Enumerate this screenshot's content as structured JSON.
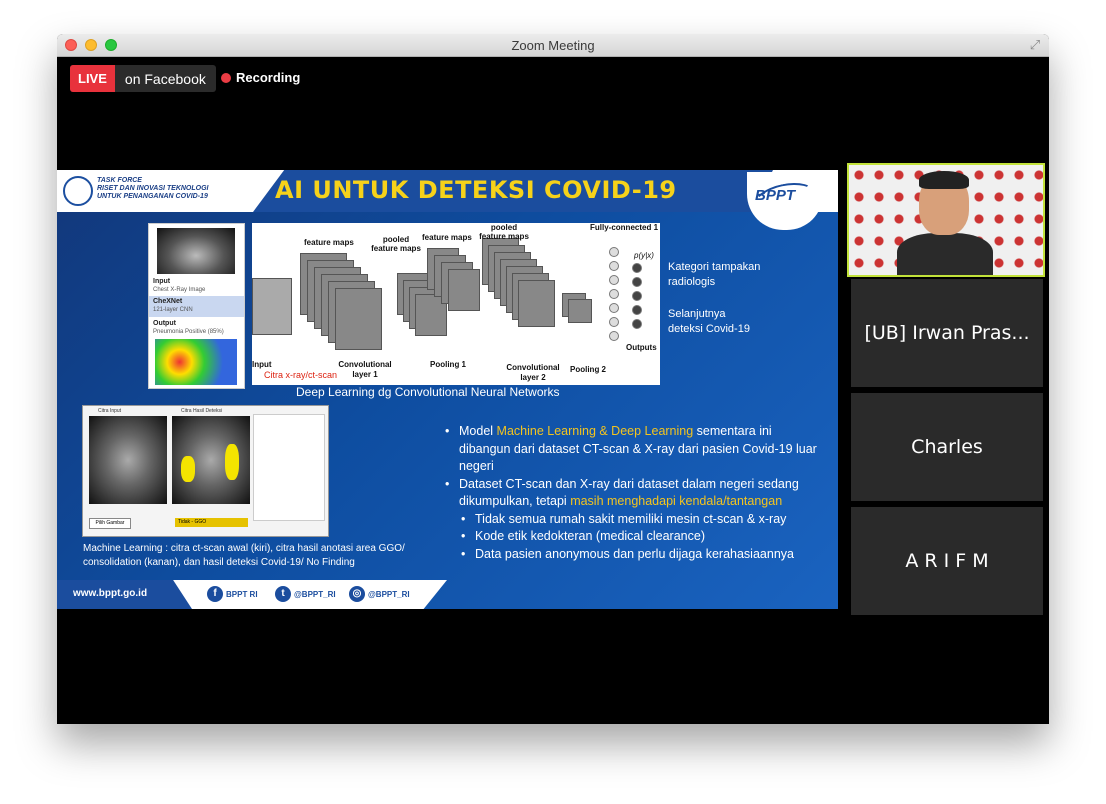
{
  "window": {
    "title": "Zoom Meeting"
  },
  "live": {
    "tag": "LIVE",
    "destination": "on Facebook"
  },
  "recording": {
    "label": "Recording"
  },
  "slide": {
    "taskforce": [
      "TASK FORCE",
      "RISET DAN INOVASI TEKNOLOGI",
      "UNTUK PENANGANAN COVID-19"
    ],
    "title": "AI UNTUK DETEKSI COVID-19",
    "logo_text": "BPPT",
    "xray_card": {
      "input_label": "Input",
      "input_sub": "Chest X-Ray Image",
      "model_label": "CheXNet",
      "model_sub": "121-layer CNN",
      "output_label": "Output",
      "output_sub": "Pneumonia Positive (85%)"
    },
    "cnn": {
      "feature_maps_1": "feature maps",
      "pooled_1": "pooled feature maps",
      "feature_maps_2": "feature maps",
      "pooled_2": "pooled feature maps",
      "fully_connected": "Fully-connected 1",
      "input": "Input",
      "conv1": "Convolutional layer 1",
      "pool1": "Pooling 1",
      "conv2": "Convolutional layer 2",
      "pool2": "Pooling 2",
      "outputs": "Outputs",
      "prob": "p(y|x)"
    },
    "citra_label": "Citra x-ray/ct-scan",
    "cnn_caption": "Deep Learning dg Convolutional Neural Networks",
    "kategori": [
      "Kategori tampakan",
      "radiologis"
    ],
    "selanjutnya": [
      "Selanjutnya",
      "deteksi Covid-19"
    ],
    "ct_card": {
      "left_title": "Citra Input",
      "right_title": "Citra Hasil Deteksi",
      "button": "Pilih Gambar",
      "status": "Tidak - GGO"
    },
    "ml_caption": "Machine Learning : citra ct-scan awal (kiri), citra hasil anotasi area GGO/ consolidation (kanan), dan hasil deteksi Covid-19/ No Finding",
    "bullets": [
      {
        "parts": [
          {
            "text": "Model ",
            "hl": false
          },
          {
            "text": "Machine Learning & Deep Learning",
            "hl": true
          },
          {
            "text": " sementara ini dibangun dari dataset CT-scan & X-ray dari pasien Covid-19 luar negeri",
            "hl": false
          }
        ]
      },
      {
        "parts": [
          {
            "text": "Dataset CT-scan dan X-ray dari dataset dalam negeri sedang dikumpulkan, tetapi ",
            "hl": false
          },
          {
            "text": "masih menghadapi kendala/tantangan",
            "hl": true
          }
        ]
      }
    ],
    "sub_bullets": [
      "Tidak semua rumah sakit memiliki mesin ct-scan & x-ray",
      "Kode etik kedokteran (medical clearance)",
      "Data pasien anonymous dan perlu dijaga kerahasiaannya"
    ],
    "footer": {
      "url": "www.bppt.go.id",
      "facebook": "BPPT RI",
      "twitter": "@BPPT_RI",
      "instagram": "@BPPT_RI"
    }
  },
  "participants": [
    {
      "name": "[UB] Irwan Pras..."
    },
    {
      "name": "Charles"
    },
    {
      "name": "A R I F M"
    }
  ]
}
